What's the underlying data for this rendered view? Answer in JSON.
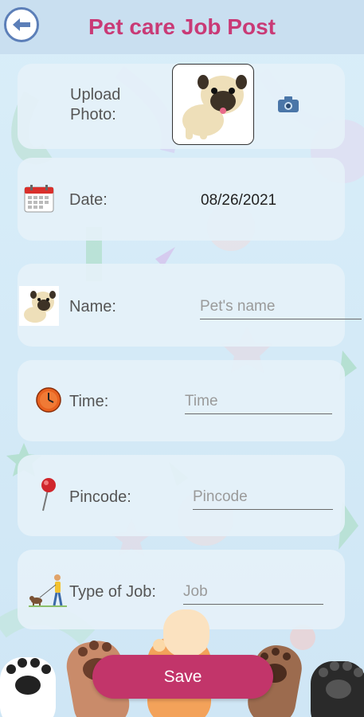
{
  "header": {
    "title": "Pet care Job Post"
  },
  "upload": {
    "label": "Upload Photo:"
  },
  "date": {
    "label": "Date:",
    "value": "08/26/2021"
  },
  "name": {
    "label": "Name:",
    "placeholder": "Pet's name"
  },
  "time": {
    "label": "Time:",
    "placeholder": "Time"
  },
  "pincode": {
    "label": "Pincode:",
    "placeholder": "Pincode"
  },
  "job_type": {
    "label": "Type of Job:",
    "placeholder": "Job"
  },
  "save": {
    "label": "Save"
  },
  "colors": {
    "title": "#c93a76",
    "save_button": "#c2356a",
    "header_bg": "#c9dff0"
  },
  "icons": [
    "back-arrow-icon",
    "pug-photo",
    "camera-icon",
    "calendar-icon",
    "pug-icon",
    "clock-icon",
    "pin-icon",
    "dog-walker-icon",
    "paw-print-decoration"
  ]
}
